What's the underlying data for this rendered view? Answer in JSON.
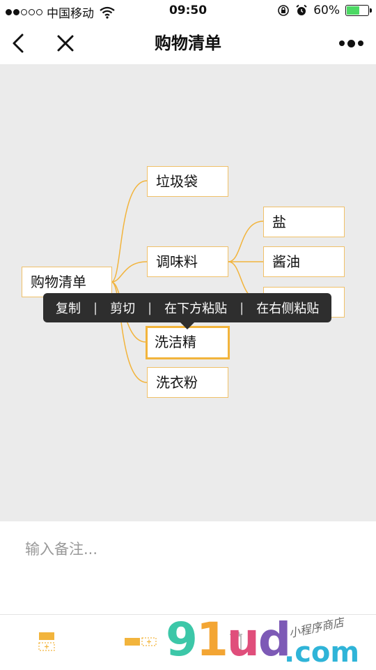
{
  "status_bar": {
    "carrier": "中国移动",
    "time": "09:50",
    "battery_pct": "60%",
    "battery_level": 0.6,
    "signal_bars": 2
  },
  "nav": {
    "title": "购物清单"
  },
  "mindmap": {
    "root": "购物清单",
    "children": [
      {
        "label": "垃圾袋"
      },
      {
        "label": "调味料",
        "children": [
          {
            "label": "盐"
          },
          {
            "label": "酱油"
          },
          {
            "label": ""
          }
        ]
      },
      {
        "label": "洗洁精",
        "selected": true
      },
      {
        "label": "洗衣粉"
      }
    ],
    "link_color": "#f2b43c"
  },
  "context_menu": {
    "items": [
      "复制",
      "剪切",
      "在下方粘贴",
      "在右侧粘贴"
    ],
    "separator": "|"
  },
  "note": {
    "placeholder": "输入备注..."
  },
  "toolbar": {
    "accent": "#f2b43c",
    "icons": [
      "add-child-node-icon",
      "add-sibling-node-icon",
      "delete-node-icon"
    ]
  },
  "watermark": {
    "brand": "91ud",
    "domain": ".com",
    "tagline": "小程序商店"
  }
}
